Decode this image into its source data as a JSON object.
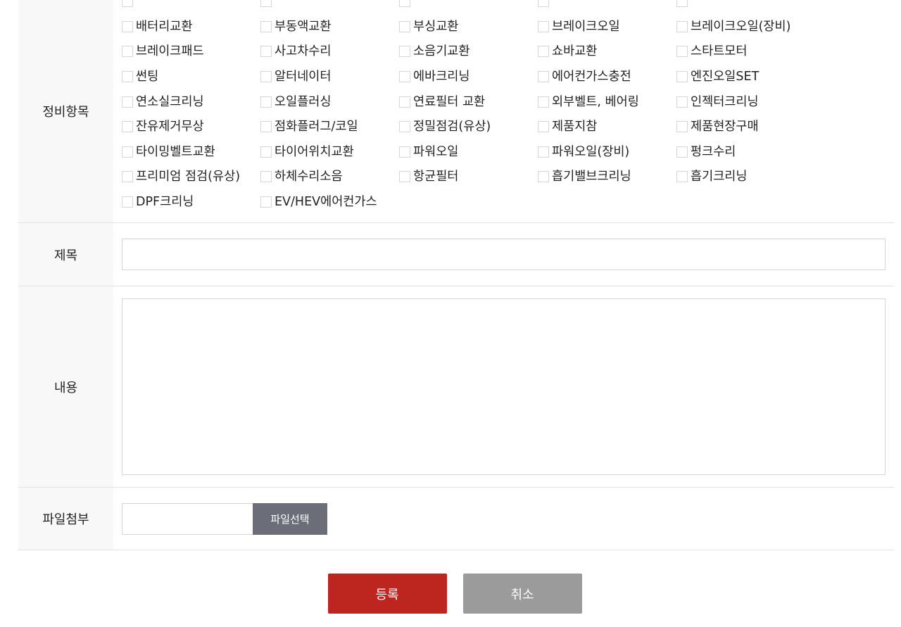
{
  "form": {
    "services_label": "정비항목",
    "services": [
      "",
      "",
      "",
      "",
      "",
      "배터리교환",
      "부동액교환",
      "부싱교환",
      "브레이크오일",
      "브레이크오일(장비)",
      "브레이크패드",
      "사고차수리",
      "소음기교환",
      "쇼바교환",
      "스타트모터",
      "썬팅",
      "알터네이터",
      "에바크리닝",
      "에어컨가스충전",
      "엔진오일SET",
      "연소실크리닝",
      "오일플러싱",
      "연료필터 교환",
      "외부벨트, 베어링",
      "인젝터크리닝",
      "잔유제거무상",
      "점화플러그/코일",
      "정밀점검(유상)",
      "제품지참",
      "제품현장구매",
      "타이밍벨트교환",
      "타이어위치교환",
      "파워오일",
      "파워오일(장비)",
      "펑크수리",
      "프리미엄 점검(유상)",
      "하체수리소음",
      "항균필터",
      "흡기밸브크리닝",
      "흡기크리닝",
      "DPF크리닝",
      "EV/HEV에어컨가스"
    ],
    "title_label": "제목",
    "title_value": "",
    "content_label": "내용",
    "content_value": "",
    "file_label": "파일첨부",
    "file_value": "",
    "file_button": "파일선택"
  },
  "actions": {
    "submit_label": "등록",
    "cancel_label": "취소"
  },
  "colors": {
    "submit": "#bc261f",
    "cancel": "#9b9b9b",
    "file_button": "#6b6e78",
    "label_bg": "#f8f8f8"
  }
}
